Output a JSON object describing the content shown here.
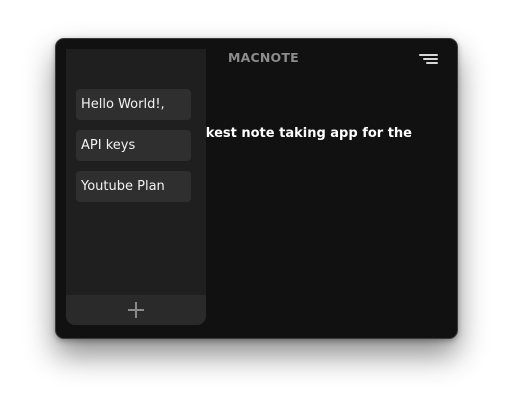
{
  "app": {
    "title": "MACNOTE"
  },
  "window_controls": {
    "close_color": "#ff5f57",
    "minimize_color": "#febc2e",
    "maximize_color": "#28c840"
  },
  "toolbar": {
    "menu_icon": "menu-lines-icon"
  },
  "sidebar": {
    "items": [
      {
        "label": "Hello World!,"
      },
      {
        "label": "API keys"
      },
      {
        "label": "Youtube Plan"
      }
    ],
    "add_icon": "plus-icon"
  },
  "editor": {
    "visible_text": "ckest note taking app for the"
  },
  "colors": {
    "window_bg": "#111111",
    "sidebar_bg": "#1f1f1f",
    "item_bg": "#2f2f2f",
    "accent_text": "#ffffff"
  }
}
